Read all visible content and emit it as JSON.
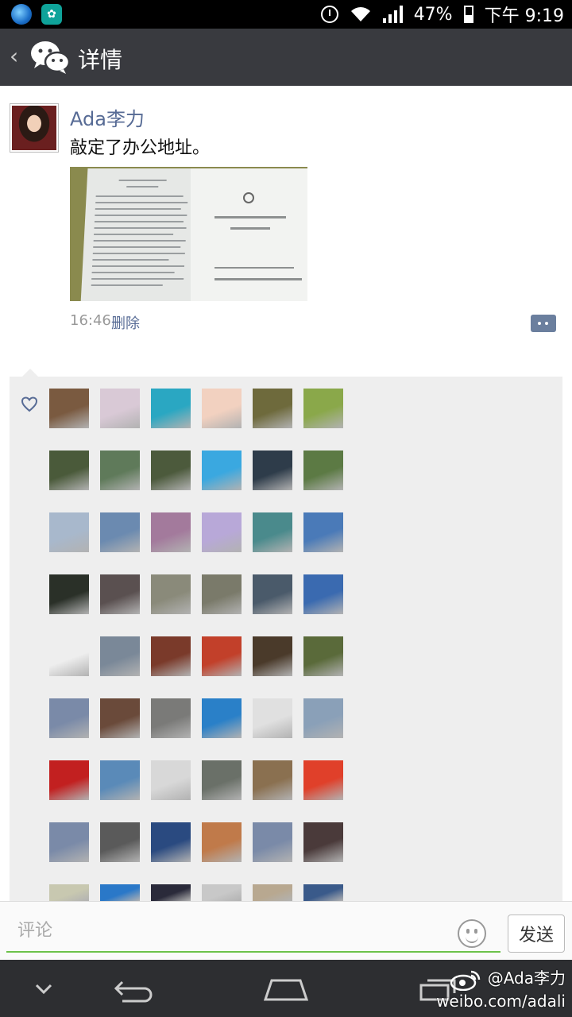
{
  "status_bar": {
    "battery_percent": "47%",
    "time": "下午 9:19",
    "icons": [
      "globe-app-icon",
      "huawei-app-icon",
      "alarm-icon",
      "wifi-icon",
      "signal-icon",
      "battery-icon"
    ]
  },
  "header": {
    "title": "详情",
    "back_icon": "back-chevron-icon",
    "logo_icon": "wechat-logo-icon"
  },
  "post": {
    "author": "Ada李力",
    "text": "敲定了办公地址。",
    "time": "16:46",
    "delete_label": "删除",
    "photo_icon": "document-photo"
  },
  "likes": {
    "icon": "heart-icon",
    "avatar_count_visible": 54,
    "avatar_colors": [
      "#7a5a40",
      "#d9c9d6",
      "#2aa7c2",
      "#f2d1c0",
      "#6e6a3c",
      "#8aa84a",
      "#4a5a3a",
      "#5f7a5a",
      "#4c5a3c",
      "#3aa8e0",
      "#2e3c4a",
      "#5c7a44",
      "#a8b8cc",
      "#6b8ab0",
      "#a37a9c",
      "#b8a8d8",
      "#4a8a8c",
      "#4a7ab8",
      "#2a3028",
      "#5a5050",
      "#8a8a7a",
      "#7a7a6a",
      "#4a5a6a",
      "#3a6ab0",
      "#eeeeee",
      "#7a8898",
      "#7a3a2a",
      "#c2402a",
      "#4a3a2a",
      "#5a6a3a",
      "#7a8aa8",
      "#6a4a3a",
      "#7a7a78",
      "#2a80c8",
      "#e0e0e0",
      "#8aa0b8",
      "#c22020",
      "#5a8ab8",
      "#d8d8d8",
      "#6a7068",
      "#8a7050",
      "#e0402a",
      "#7a8aa8",
      "#5a5a5a",
      "#2a4a80",
      "#c07a4a",
      "#7a8aa8",
      "#4a3a3a",
      "#c8c8b0",
      "#2a78c8",
      "#2a2a3a",
      "#c8c8c8",
      "#b8a890",
      "#3a5a8a"
    ]
  },
  "comment_bar": {
    "placeholder": "评论",
    "send_label": "发送",
    "emoji_icon": "smiley-icon"
  },
  "nav_bar": {
    "icons": [
      "collapse-chevron-icon",
      "back-nav-icon",
      "home-nav-icon",
      "recent-apps-icon"
    ]
  },
  "watermark": {
    "line1": "@Ada李力",
    "line2": "weibo.com/adali",
    "logo_icon": "weibo-logo-icon"
  }
}
